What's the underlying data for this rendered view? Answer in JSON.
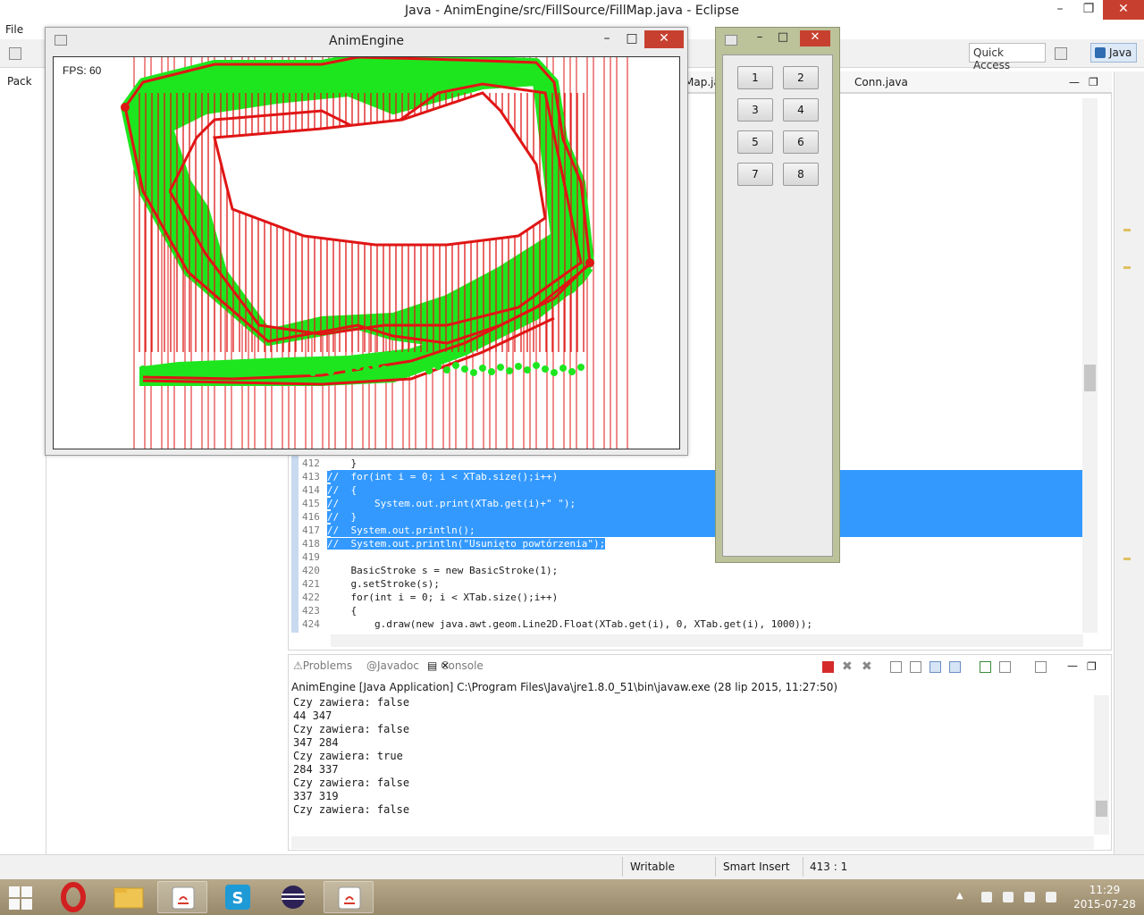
{
  "eclipse": {
    "title": "Java - AnimEngine/src/FillSource/FillMap.java - Eclipse",
    "menu": {
      "file": "File"
    },
    "quick_access": "Quick Access",
    "perspective": "Java",
    "package_explorer_tab": "Pack",
    "editor_tabs": [
      "Map.ja",
      "Conn.java"
    ]
  },
  "editor": {
    "lines": [
      {
        "n": "412",
        "t": "    }",
        "sel": false
      },
      {
        "n": "413",
        "t": "//  for(int i = 0; i < XTab.size();i++)",
        "sel": true
      },
      {
        "n": "414",
        "t": "//  {",
        "sel": true
      },
      {
        "n": "415",
        "t": "//      System.out.print(XTab.get(i)+\" \");",
        "sel": true
      },
      {
        "n": "416",
        "t": "//  }",
        "sel": true
      },
      {
        "n": "417",
        "t": "//  System.out.println();",
        "sel": true
      },
      {
        "n": "418",
        "t": "//  System.out.println(\"Usunięto powtórzenia\");",
        "sel": true
      },
      {
        "n": "419",
        "t": "",
        "sel": false
      },
      {
        "n": "420",
        "t": "    BasicStroke s = new BasicStroke(1);",
        "sel": false
      },
      {
        "n": "421",
        "t": "    g.setStroke(s);",
        "sel": false
      },
      {
        "n": "422",
        "t": "    for(int i = 0; i < XTab.size();i++)",
        "sel": false
      },
      {
        "n": "423",
        "t": "    {",
        "sel": false
      },
      {
        "n": "424",
        "t": "        g.draw(new java.awt.geom.Line2D.Float(XTab.get(i), 0, XTab.get(i), 1000));",
        "sel": false
      }
    ]
  },
  "console": {
    "tabs": {
      "problems": "Problems",
      "javadoc": "Javadoc",
      "console": "Console"
    },
    "description": "AnimEngine [Java Application] C:\\Program Files\\Java\\jre1.8.0_51\\bin\\javaw.exe (28 lip 2015, 11:27:50)",
    "lines": [
      "Czy zawiera: false",
      "44 347",
      "Czy zawiera: false",
      "347 284",
      "Czy zawiera: true",
      "284 337",
      "Czy zawiera: false",
      "337 319",
      "Czy zawiera: false"
    ]
  },
  "statusbar": {
    "writable": "Writable",
    "insert_mode": "Smart Insert",
    "position": "413 : 1"
  },
  "anim": {
    "title": "AnimEngine",
    "fps": "FPS: 60"
  },
  "buttons": [
    "1",
    "2",
    "3",
    "4",
    "5",
    "6",
    "7",
    "8"
  ],
  "taskbar": {
    "time": "11:29",
    "date": "2015-07-28"
  },
  "colors": {
    "fill_green": "#1ee61e",
    "outline_red": "#e01515",
    "selection": "#3399ff",
    "close_red": "#c7402f"
  }
}
